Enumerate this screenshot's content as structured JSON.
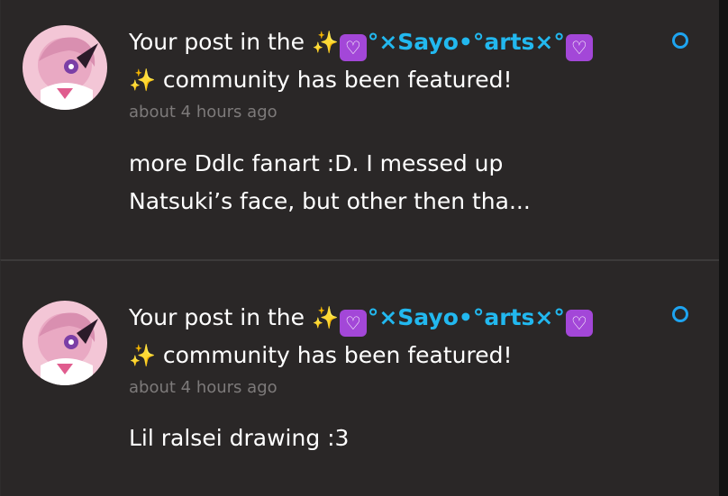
{
  "notifications": [
    {
      "headline_prefix": "Your post in the ",
      "sparkle_left": "✨",
      "heart_left": "♡",
      "community_name": "°×Sayo•°arts×°",
      "heart_right": "♡",
      "sparkle_right": "✨",
      "headline_suffix": " community has been featured!",
      "timestamp": "about 4 hours ago",
      "excerpt_line1": "more Ddlc fanart :D. I messed up",
      "excerpt_line2": "Natsuki’s face, but other then tha...",
      "unread": true
    },
    {
      "headline_prefix": "Your post in the ",
      "sparkle_left": "✨",
      "heart_left": "♡",
      "community_name": "°×Sayo•°arts×°",
      "heart_right": "♡",
      "sparkle_right": "✨",
      "headline_suffix": " community has been featured!",
      "timestamp": "about 4 hours ago",
      "excerpt_line1": "Lil ralsei drawing :3",
      "excerpt_line2": "",
      "unread": true
    }
  ],
  "colors": {
    "background": "#2a2727",
    "community_name": "#22b8ef",
    "unread_indicator": "#1ea4f0",
    "timestamp": "#7d7a7a",
    "heart_badge": "#a347d8"
  },
  "icons": {
    "avatar": "pink-anime-character-avatar",
    "unread": "unread-circle-icon",
    "sparkle": "sparkles-emoji",
    "heart": "white-heart-purple-square-emoji"
  }
}
